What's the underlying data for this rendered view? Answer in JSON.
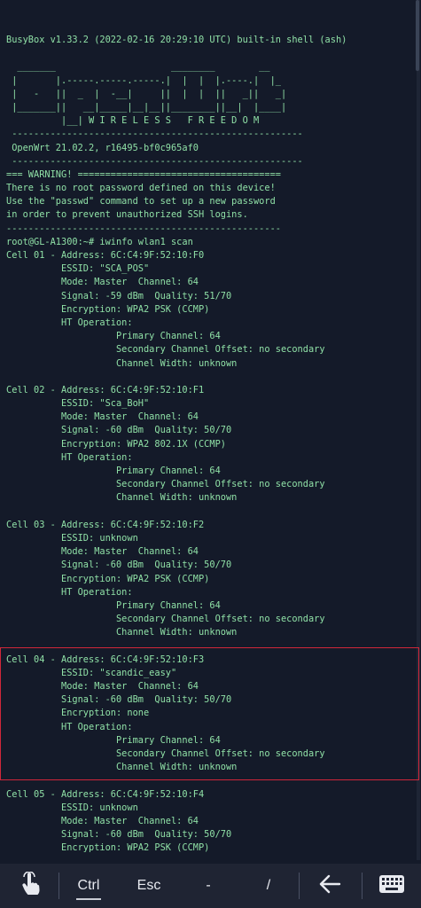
{
  "terminal": {
    "lines": [
      "BusyBox v1.33.2 (2022-02-16 20:29:10 UTC) built-in shell (ash)",
      "",
      "  _______                     ________        __",
      " |       |.-----.-----.-----.|  |  |  |.----.|  |_",
      " |   -   ||  _  |  -__|     ||  |  |  ||   _||   _|",
      " |_______||   __|_____|__|__||________||__|  |____|",
      "          |__| W I R E L E S S   F R E E D O M",
      " -----------------------------------------------------",
      " OpenWrt 21.02.2, r16495-bf0c965af0",
      " -----------------------------------------------------",
      "=== WARNING! =====================================",
      "There is no root password defined on this device!",
      "Use the \"passwd\" command to set up a new password",
      "in order to prevent unauthorized SSH logins.",
      "--------------------------------------------------",
      "root@GL-A1300:~# iwinfo wlan1 scan",
      "Cell 01 - Address: 6C:C4:9F:52:10:F0",
      "          ESSID: \"SCA_POS\"",
      "          Mode: Master  Channel: 64",
      "          Signal: -59 dBm  Quality: 51/70",
      "          Encryption: WPA2 PSK (CCMP)",
      "          HT Operation:",
      "                    Primary Channel: 64",
      "                    Secondary Channel Offset: no secondary",
      "                    Channel Width: unknown",
      "",
      "Cell 02 - Address: 6C:C4:9F:52:10:F1",
      "          ESSID: \"Sca_BoH\"",
      "          Mode: Master  Channel: 64",
      "          Signal: -60 dBm  Quality: 50/70",
      "          Encryption: WPA2 802.1X (CCMP)",
      "          HT Operation:",
      "                    Primary Channel: 64",
      "                    Secondary Channel Offset: no secondary",
      "                    Channel Width: unknown",
      "",
      "Cell 03 - Address: 6C:C4:9F:52:10:F2",
      "          ESSID: unknown",
      "          Mode: Master  Channel: 64",
      "          Signal: -60 dBm  Quality: 50/70",
      "          Encryption: WPA2 PSK (CCMP)",
      "          HT Operation:",
      "                    Primary Channel: 64",
      "                    Secondary Channel Offset: no secondary",
      "                    Channel Width: unknown",
      "",
      "Cell 04 - Address: 6C:C4:9F:52:10:F3",
      "          ESSID: \"scandic_easy\"",
      "          Mode: Master  Channel: 64",
      "          Signal: -60 dBm  Quality: 50/70",
      "          Encryption: none",
      "          HT Operation:",
      "                    Primary Channel: 64",
      "                    Secondary Channel Offset: no secondary",
      "                    Channel Width: unknown",
      "",
      "Cell 05 - Address: 6C:C4:9F:52:10:F4",
      "          ESSID: unknown",
      "          Mode: Master  Channel: 64",
      "          Signal: -60 dBm  Quality: 50/70",
      "          Encryption: WPA2 PSK (CCMP)"
    ]
  },
  "colors": {
    "background": "#141a29",
    "text": "#8fe0a6",
    "highlight": "#d0273a",
    "keybar": "#1f2433"
  },
  "keybar": {
    "touch_icon": "touch-hand-icon",
    "ctrl_label": "Ctrl",
    "esc_label": "Esc",
    "dash_label": "-",
    "slash_label": "/",
    "back_icon": "arrow-left-icon",
    "keyboard_icon": "keyboard-icon"
  }
}
